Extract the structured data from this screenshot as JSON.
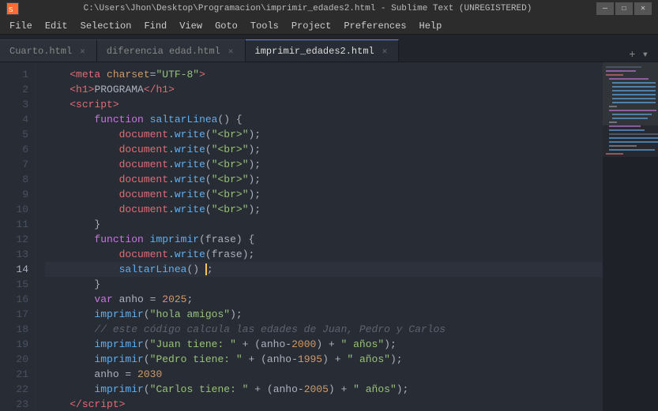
{
  "titlebar": {
    "path": "C:\\Users\\Jhon\\Desktop\\Programacion\\imprimir_edades2.html - Sublime Text (UNREGISTERED)",
    "minimize": "—",
    "maximize": "☐",
    "close": "✕"
  },
  "menu": {
    "items": [
      "File",
      "Edit",
      "Selection",
      "Find",
      "View",
      "Goto",
      "Tools",
      "Project",
      "Preferences",
      "Help"
    ]
  },
  "tabs": [
    {
      "id": "tab1",
      "label": "Cuarto.html",
      "active": false
    },
    {
      "id": "tab2",
      "label": "diferencia edad.html",
      "active": false
    },
    {
      "id": "tab3",
      "label": "imprimir_edades2.html",
      "active": true
    }
  ],
  "lines": [
    {
      "num": 1,
      "active": false
    },
    {
      "num": 2,
      "active": false
    },
    {
      "num": 3,
      "active": false
    },
    {
      "num": 4,
      "active": false
    },
    {
      "num": 5,
      "active": false
    },
    {
      "num": 6,
      "active": false
    },
    {
      "num": 7,
      "active": false
    },
    {
      "num": 8,
      "active": false
    },
    {
      "num": 9,
      "active": false
    },
    {
      "num": 10,
      "active": false
    },
    {
      "num": 11,
      "active": false
    },
    {
      "num": 12,
      "active": false
    },
    {
      "num": 13,
      "active": false
    },
    {
      "num": 14,
      "active": true
    },
    {
      "num": 15,
      "active": false
    },
    {
      "num": 16,
      "active": false
    },
    {
      "num": 17,
      "active": false
    },
    {
      "num": 18,
      "active": false
    },
    {
      "num": 19,
      "active": false
    },
    {
      "num": 20,
      "active": false
    },
    {
      "num": 21,
      "active": false
    },
    {
      "num": 22,
      "active": false
    },
    {
      "num": 23,
      "active": false
    }
  ]
}
